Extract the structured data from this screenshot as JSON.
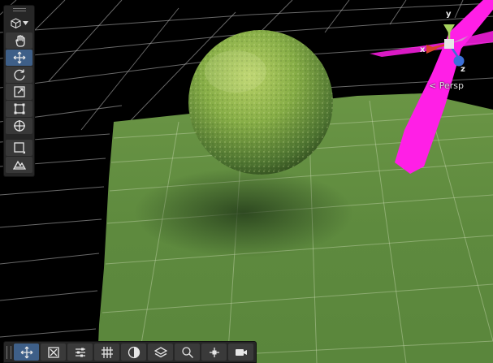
{
  "scene": {
    "camera_mode": "Persp",
    "axis_labels": {
      "x": "x",
      "y": "y",
      "z": "z"
    }
  },
  "colors": {
    "background": "#000000",
    "grid_line": "#bdbdbd",
    "ground": "#5a8a3c",
    "sphere_light": "#a7c85a",
    "sphere_dark": "#42612a",
    "missing_material": "#ff1fe6",
    "toolbar_bg": "#262626",
    "tool_active": "#3e5f88",
    "axis_x": "#d8442b",
    "axis_y": "#a6d25e",
    "axis_z": "#3b6fd8"
  },
  "tools": [
    {
      "name": "view-tool",
      "icon": "hand-icon",
      "active": false
    },
    {
      "name": "move-tool",
      "icon": "move-icon",
      "active": true
    },
    {
      "name": "rotate-tool",
      "icon": "rotate-icon",
      "active": false
    },
    {
      "name": "scale-tool",
      "icon": "scale-icon",
      "active": false
    },
    {
      "name": "rect-tool",
      "icon": "rect-transform-icon",
      "active": false
    },
    {
      "name": "transform-tool",
      "icon": "transform-icon",
      "active": false
    }
  ],
  "extra_tools": [
    {
      "name": "custom-shape-tool",
      "icon": "square-icon"
    },
    {
      "name": "terrain-tool",
      "icon": "terrain-icon"
    }
  ],
  "bottom_tools": [
    {
      "name": "move-overlay",
      "icon": "move-icon",
      "active": true
    },
    {
      "name": "mirror-overlay",
      "icon": "mirror-icon",
      "active": false
    },
    {
      "name": "adjust-overlay",
      "icon": "sliders-icon",
      "active": false
    },
    {
      "name": "grid-overlay",
      "icon": "grid-icon",
      "active": false
    },
    {
      "name": "shading-overlay",
      "icon": "sphere-icon",
      "active": false
    },
    {
      "name": "layers-overlay",
      "icon": "layers-icon",
      "active": false
    },
    {
      "name": "search-overlay",
      "icon": "search-icon",
      "active": false
    },
    {
      "name": "pivot-overlay",
      "icon": "pivot-icon",
      "active": false
    },
    {
      "name": "camera-overlay",
      "icon": "camera-icon",
      "active": false
    }
  ]
}
